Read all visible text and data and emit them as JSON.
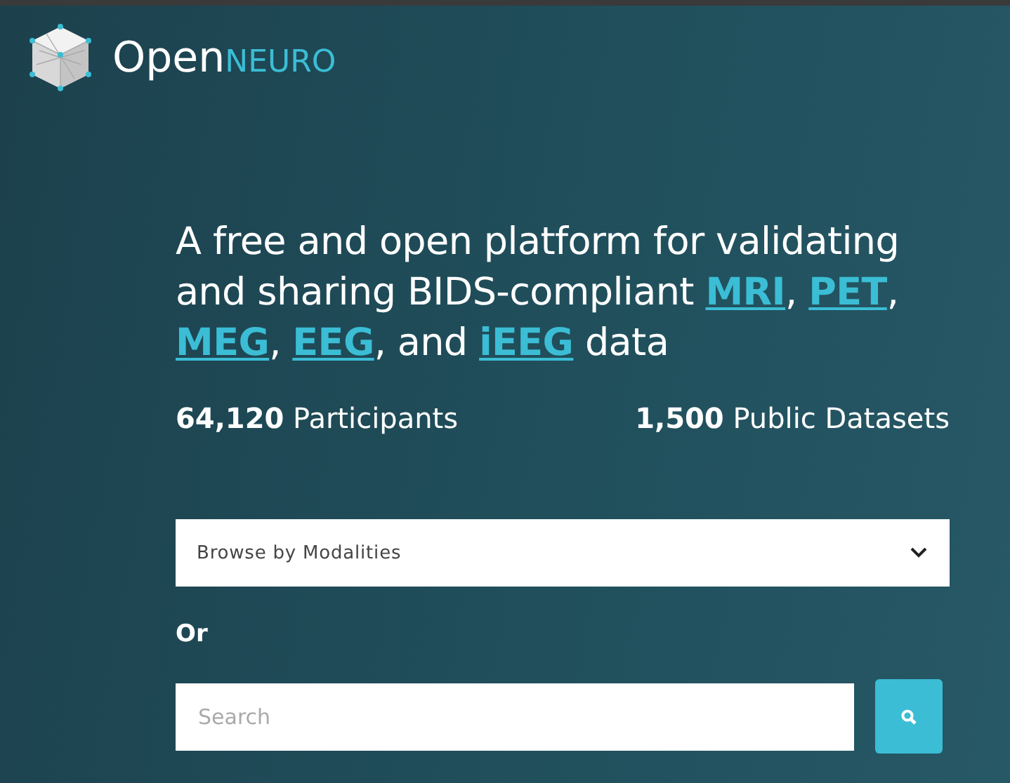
{
  "logo": {
    "word_main": "Open",
    "word_accent": "NEURO"
  },
  "headline": [
    {
      "kind": "text",
      "text": "A free and open platform for validating and sharing BIDS-compliant "
    },
    {
      "kind": "link",
      "text": "MRI"
    },
    {
      "kind": "text",
      "text": ", "
    },
    {
      "kind": "link",
      "text": "PET"
    },
    {
      "kind": "text",
      "text": ", "
    },
    {
      "kind": "link",
      "text": "MEG"
    },
    {
      "kind": "text",
      "text": ", "
    },
    {
      "kind": "link",
      "text": "EEG"
    },
    {
      "kind": "text",
      "text": ", and "
    },
    {
      "kind": "link",
      "text": "iEEG"
    },
    {
      "kind": "text",
      "text": " data"
    }
  ],
  "stats": [
    "**64,120** Participants",
    "**1,500** Public Datasets"
  ],
  "browse": {
    "label": "Browse by Modalities"
  },
  "or_label": "Or",
  "search": {
    "placeholder": "Search"
  }
}
